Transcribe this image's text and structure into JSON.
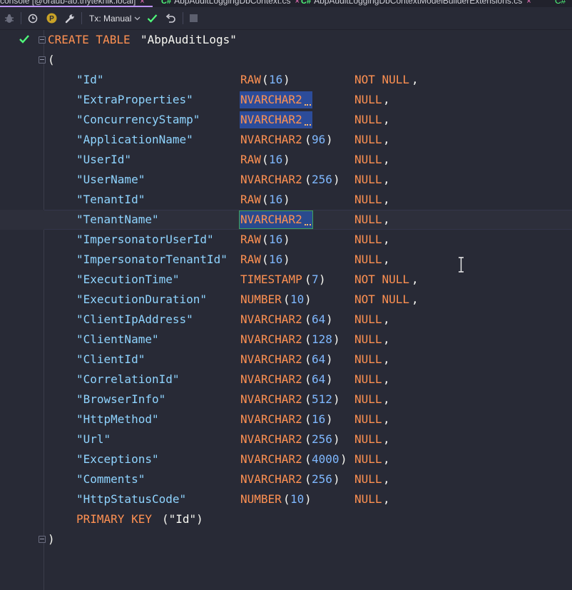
{
  "tabs": [
    {
      "label": "console [@oraub-ao.thytekhik.local]",
      "has_cs_prefix": false
    },
    {
      "label": "AbpAuditLoggingDbContext.cs",
      "has_cs_prefix": true
    },
    {
      "label": "AbpAuditLoggingDbContextModelBuilderExtensions.cs",
      "has_cs_prefix": true
    },
    {
      "label": "C#",
      "has_cs_prefix": false
    }
  ],
  "tab_close_glyph": "×",
  "cs_prefix": "C#",
  "toolbar": {
    "tx_label": "Tx: Manual",
    "icons": [
      "bug-icon",
      "history-icon",
      "p-badge-icon",
      "wrench-icon",
      "commit-check-icon",
      "rollback-icon",
      "stop-icon"
    ]
  },
  "colors": {
    "background": "#282a36",
    "keyword": "#ff9152",
    "string": "#8fd4ff",
    "number": "#7fb8ff",
    "selection": "#2c4c9a",
    "check": "#50fa7b"
  },
  "sql": {
    "create_keyword": "CREATE TABLE",
    "table_name": "\"AbpAuditLogs\"",
    "open_paren": "(",
    "close_paren": ")",
    "columns": [
      {
        "name": "\"Id\"",
        "type": "RAW",
        "size": "16",
        "constraint": "NOT NULL"
      },
      {
        "name": "\"ExtraProperties\"",
        "type": "NVARCHAR2",
        "size": "",
        "constraint": "NULL"
      },
      {
        "name": "\"ConcurrencyStamp\"",
        "type": "NVARCHAR2",
        "size": "",
        "constraint": "NULL"
      },
      {
        "name": "\"ApplicationName\"",
        "type": "NVARCHAR2",
        "size": "96",
        "constraint": "NULL"
      },
      {
        "name": "\"UserId\"",
        "type": "RAW",
        "size": "16",
        "constraint": "NULL"
      },
      {
        "name": "\"UserName\"",
        "type": "NVARCHAR2",
        "size": "256",
        "constraint": "NULL"
      },
      {
        "name": "\"TenantId\"",
        "type": "RAW",
        "size": "16",
        "constraint": "NULL"
      },
      {
        "name": "\"TenantName\"",
        "type": "NVARCHAR2",
        "size": "",
        "constraint": "NULL"
      },
      {
        "name": "\"ImpersonatorUserId\"",
        "type": "RAW",
        "size": "16",
        "constraint": "NULL"
      },
      {
        "name": "\"ImpersonatorTenantId\"",
        "type": "RAW",
        "size": "16",
        "constraint": "NULL"
      },
      {
        "name": "\"ExecutionTime\"",
        "type": "TIMESTAMP",
        "size": "7",
        "constraint": "NOT NULL"
      },
      {
        "name": "\"ExecutionDuration\"",
        "type": "NUMBER",
        "size": "10",
        "constraint": "NOT NULL"
      },
      {
        "name": "\"ClientIpAddress\"",
        "type": "NVARCHAR2",
        "size": "64",
        "constraint": "NULL"
      },
      {
        "name": "\"ClientName\"",
        "type": "NVARCHAR2",
        "size": "128",
        "constraint": "NULL"
      },
      {
        "name": "\"ClientId\"",
        "type": "NVARCHAR2",
        "size": "64",
        "constraint": "NULL"
      },
      {
        "name": "\"CorrelationId\"",
        "type": "NVARCHAR2",
        "size": "64",
        "constraint": "NULL"
      },
      {
        "name": "\"BrowserInfo\"",
        "type": "NVARCHAR2",
        "size": "512",
        "constraint": "NULL"
      },
      {
        "name": "\"HttpMethod\"",
        "type": "NVARCHAR2",
        "size": "16",
        "constraint": "NULL"
      },
      {
        "name": "\"Url\"",
        "type": "NVARCHAR2",
        "size": "256",
        "constraint": "NULL"
      },
      {
        "name": "\"Exceptions\"",
        "type": "NVARCHAR2",
        "size": "4000",
        "constraint": "NULL"
      },
      {
        "name": "\"Comments\"",
        "type": "NVARCHAR2",
        "size": "256",
        "constraint": "NULL"
      },
      {
        "name": "\"HttpStatusCode\"",
        "type": "NUMBER",
        "size": "10",
        "constraint": "NULL"
      }
    ],
    "primary_key_keyword": "PRIMARY KEY",
    "primary_key_columns": "(\"Id\")",
    "comma": ","
  }
}
